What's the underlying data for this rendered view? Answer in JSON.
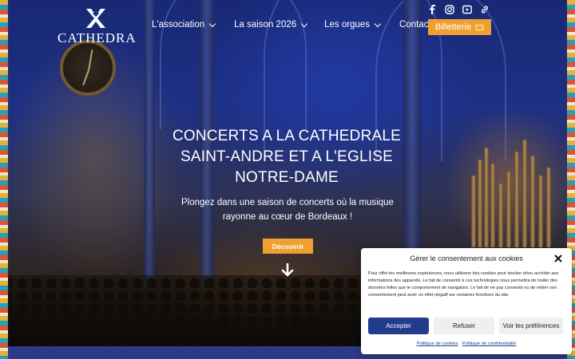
{
  "brand": {
    "logo_text": "CATHEDRA"
  },
  "nav": {
    "items": [
      {
        "label": "L'association",
        "has_dropdown": true
      },
      {
        "label": "La saison 2026",
        "has_dropdown": true
      },
      {
        "label": "Les orgues",
        "has_dropdown": true
      },
      {
        "label": "Contact",
        "has_dropdown": false
      }
    ]
  },
  "socials": [
    "facebook-icon",
    "instagram-icon",
    "youtube-icon",
    "link-icon"
  ],
  "billetterie": {
    "label": "Billetterie",
    "icon": "ticket-icon"
  },
  "hero": {
    "title_lines": [
      "CONCERTS A LA CATHEDRALE",
      "SAINT-ANDRE ET A L'EGLISE",
      "NOTRE-DAME"
    ],
    "subtitle_lines": [
      "Plongez dans une saison de concerts où la musique",
      "rayonne au cœur de Bordeaux !"
    ],
    "cta": "Découvrir"
  },
  "consent": {
    "title": "Gérer le consentement aux cookies",
    "body": "Pour offrir les meilleures expériences, nous utilisons des cookies pour stocker et/ou accéder aux informations des appareils. Le fait de consentir à ces technologies nous permettra de traiter des données telles que le comportement de navigation. Le fait de ne pas consentir ou de retirer son consentement peut avoir un effet négatif sur certaines fonctions du site.",
    "accept": "Accepter",
    "refuse": "Refuser",
    "preferences": "Voir les préférences",
    "links": [
      "Politique de cookies",
      "Politique de confidentialité"
    ]
  },
  "colors": {
    "accent": "#f0a030",
    "primary": "#223c8c"
  }
}
